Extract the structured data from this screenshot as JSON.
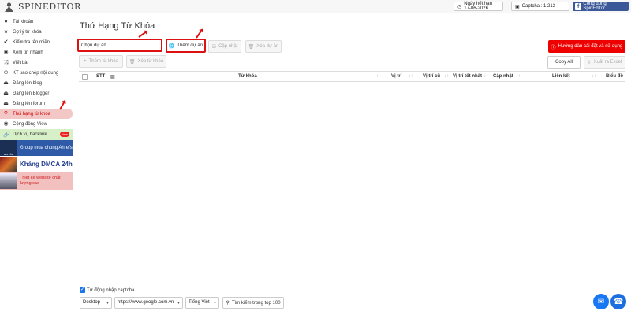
{
  "app": {
    "logo_text": "SPINEDITOR"
  },
  "topbar": {
    "expiry": "Ngày hết hạn 17-06-2026",
    "captcha": "Captcha : 1,213",
    "fb_label": "Cộng đồng SpinEditor"
  },
  "sidebar": {
    "items": [
      {
        "label": "Tài khoản",
        "icon": "user-icon"
      },
      {
        "label": "Gợi ý từ khóa",
        "icon": "star-icon"
      },
      {
        "label": "Kiểm tra tên miền",
        "icon": "check-icon"
      },
      {
        "label": "Xem tin nhanh",
        "icon": "eye-icon"
      },
      {
        "label": "Viết bài",
        "icon": "shuffle-icon"
      },
      {
        "label": "KT sao chép nội dung",
        "icon": "copy-check-icon"
      },
      {
        "label": "Đăng lên blog",
        "icon": "upload-icon"
      },
      {
        "label": "Đăng lên Blogger",
        "icon": "upload-icon"
      },
      {
        "label": "Đăng lên forum",
        "icon": "upload-icon"
      },
      {
        "label": "Thứ hạng từ khóa",
        "icon": "search-icon"
      },
      {
        "label": "Cộng đồng View",
        "icon": "eye-icon"
      }
    ],
    "backlink": {
      "label": "Dịch vụ backlink",
      "tag": "New"
    },
    "banners": {
      "ahrefs": {
        "label": "Group mua chung Ahrefs",
        "thumb_text": "ahrefs"
      },
      "dmca": {
        "label": "Kháng DMCA 24h"
      },
      "web": {
        "label": "Thiết kế website chất lượng cao"
      }
    }
  },
  "main": {
    "title": "Thứ Hạng Từ Khóa",
    "project_select": "Chọn dự án",
    "add_project": "Thêm dự án",
    "update": "Cập nhật",
    "delete_project": "Xóa dự án",
    "add_keyword": "Thêm từ khóa",
    "delete_keyword": "Xóa từ khóa",
    "guide": "Hướng dẫn cài đặt và sử dụng",
    "copy_all": "Copy All",
    "export": "Xuất ra Excel"
  },
  "table": {
    "columns": {
      "stt": "STT",
      "keyword": "Từ khóa",
      "position": "Vị trí",
      "old_position": "Vị trí cũ",
      "best_position": "Vị trí tốt nhất",
      "updated": "Cập nhật",
      "link": "Liên kết",
      "chart": "Biểu đồ"
    }
  },
  "footer": {
    "auto_captcha": "Tự động nhập captcha",
    "device": "Desktop",
    "google": "https://www.google.com.vn",
    "language": "Tiếng Việt",
    "search_top": "Tìm kiếm trong top 100"
  },
  "colors": {
    "accent_red": "#dd1111",
    "fb_blue": "#3b5998",
    "active_bg": "#f4c7c7"
  }
}
